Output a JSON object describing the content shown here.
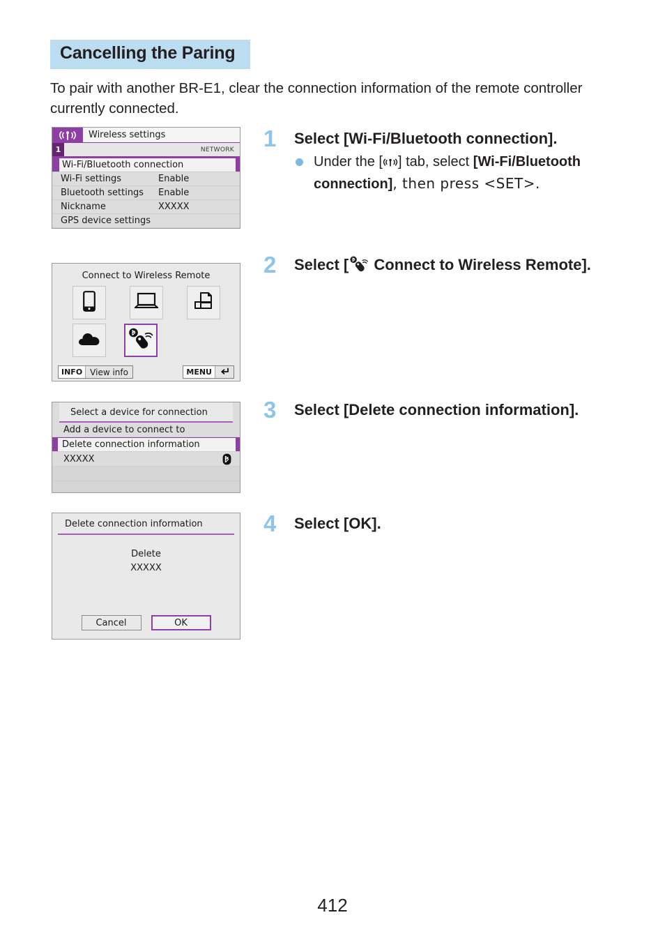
{
  "document": {
    "page_number": "412"
  },
  "heading": {
    "title": "Cancelling the Paring"
  },
  "intro": {
    "text": "To pair with another BR-E1, clear the connection information of the remote controller currently connected."
  },
  "screenshots": {
    "wireless_settings": {
      "tab_icon": "wifi-tab-icon",
      "title": "Wireless settings",
      "page_indicator": "1",
      "group_label": "NETWORK",
      "rows": [
        {
          "label": "Wi-Fi/Bluetooth connection",
          "value": "",
          "selected": true
        },
        {
          "label": "Wi-Fi settings",
          "value": "Enable",
          "selected": false
        },
        {
          "label": "Bluetooth settings",
          "value": "Enable",
          "selected": false
        },
        {
          "label": "Nickname",
          "value": "XXXXX",
          "selected": false
        },
        {
          "label": "GPS device settings",
          "value": "",
          "selected": false
        }
      ]
    },
    "connect_wireless_remote": {
      "title": "Connect to Wireless Remote",
      "tiles": [
        {
          "icon": "smartphone-icon",
          "selected": false
        },
        {
          "icon": "laptop-icon",
          "selected": false
        },
        {
          "icon": "printer-icon",
          "selected": false
        },
        {
          "icon": "cloud-icon",
          "selected": false
        },
        {
          "icon": "wireless-remote-icon",
          "selected": true
        }
      ],
      "info_key": "INFO",
      "info_label": "View info",
      "menu_key": "MENU",
      "menu_icon": "return-arrow-icon"
    },
    "select_device": {
      "title": "Select a device for connection",
      "rows": [
        {
          "label": "Add a device to connect to",
          "selected": false,
          "badge": ""
        },
        {
          "label": "Delete connection information",
          "selected": true,
          "badge": ""
        },
        {
          "label": "XXXXX",
          "selected": false,
          "badge": "bluetooth-icon"
        }
      ]
    },
    "delete_connection": {
      "title": "Delete connection information",
      "body_line1": "Delete",
      "body_line2": "XXXXX",
      "cancel_label": "Cancel",
      "ok_label": "OK"
    }
  },
  "steps": [
    {
      "number": "1",
      "heading": "Select [Wi-Fi/Bluetooth connection].",
      "bullet_before": "Under the [",
      "bullet_icon": "wifi-tab-icon",
      "bullet_mid": "] tab, select ",
      "bullet_bold": "[Wi-Fi/Bluetooth connection]",
      "bullet_after": ", then press <SET>."
    },
    {
      "number": "2",
      "heading_before": "Select [",
      "heading_icon": "wireless-remote-icon",
      "heading_after": " Connect to Wireless Remote]."
    },
    {
      "number": "3",
      "heading": "Select [Delete connection information]."
    },
    {
      "number": "4",
      "heading": "Select [OK]."
    }
  ],
  "colors": {
    "heading_highlight": "#bcdcf0",
    "step_number": "#8ec4e8",
    "bullet_dot": "#7db8e0",
    "camera_accent": "#8e3fa3",
    "camera_tab": "#63256f",
    "text": "#231f20"
  }
}
